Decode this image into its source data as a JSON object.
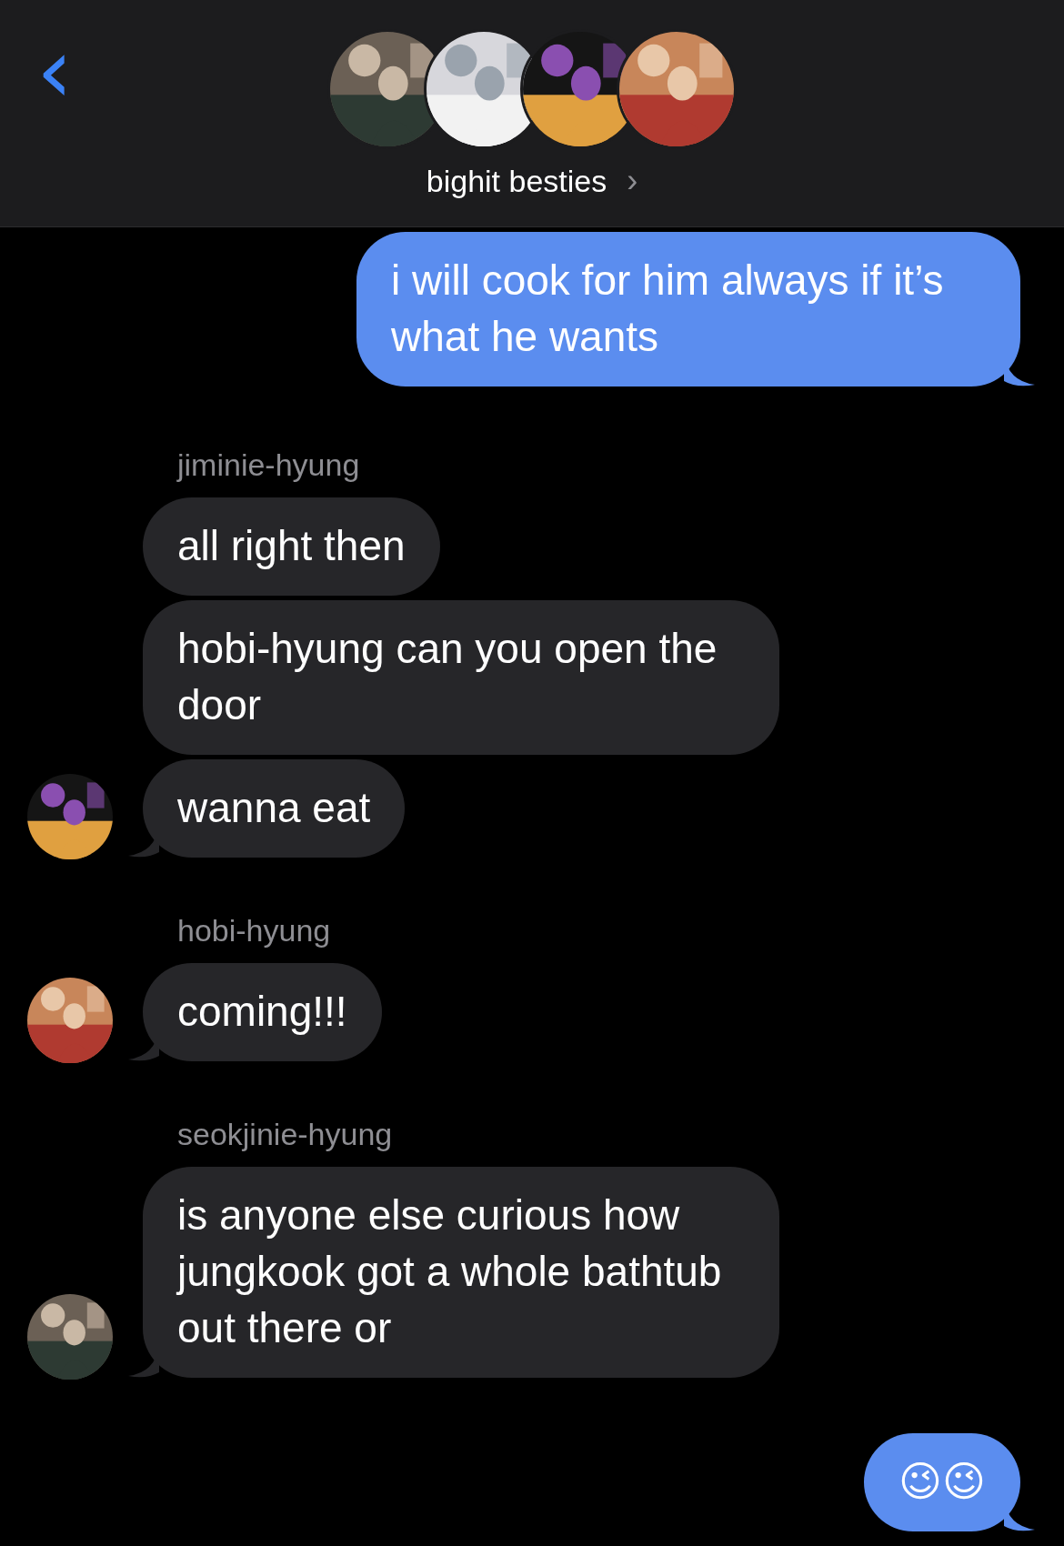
{
  "header": {
    "back": "‹",
    "title": "bighit besties",
    "chevron": "›"
  },
  "groups": [
    {
      "kind": "outgoing",
      "bubbles": [
        "i will cook for him always if it’s what he wants"
      ]
    },
    {
      "kind": "incoming",
      "sender": "jiminie-hyung",
      "bubbles": [
        "all right then",
        "hobi-hyung can you open the door",
        "wanna eat"
      ]
    },
    {
      "kind": "incoming",
      "sender": "hobi-hyung",
      "bubbles": [
        "coming!!!"
      ]
    },
    {
      "kind": "incoming",
      "sender": "seokjinie-hyung",
      "bubbles": [
        "is anyone else curious how jungkook got a whole bathtub out there or"
      ]
    },
    {
      "kind": "outgoing",
      "bubbles": [
        "😉😉"
      ]
    }
  ]
}
